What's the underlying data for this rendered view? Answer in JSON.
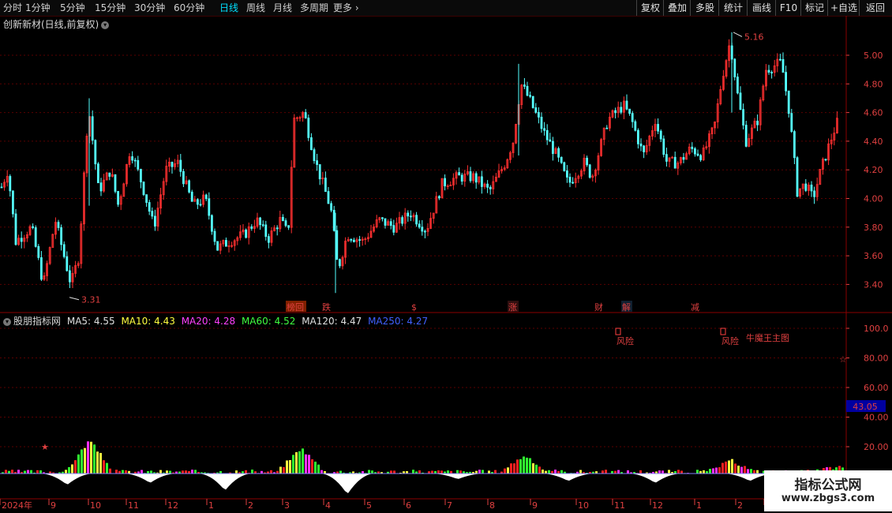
{
  "toolbar": {
    "periods": [
      "分时",
      "1分钟",
      "5分钟",
      "15分钟",
      "30分钟",
      "60分钟",
      "日线",
      "周线",
      "月线",
      "多周期",
      "更多"
    ],
    "active_period": "日线",
    "right_buttons": [
      "复权",
      "叠加",
      "多股",
      "统计",
      "画线",
      "F10",
      "标记",
      "+自选",
      "返回"
    ]
  },
  "main_chart": {
    "title": "创新新材(日线,前复权)",
    "high_label": "5.16",
    "low_label": "3.31",
    "y_ticks": [
      "5.00",
      "4.80",
      "4.60",
      "4.40",
      "4.20",
      "4.00",
      "3.80",
      "3.60",
      "3.40"
    ],
    "event_labels": [
      {
        "text": "榜回",
        "color": "#ffa040",
        "bg": "#802000"
      },
      {
        "text": "跌",
        "color": "#40ff40",
        "bg": ""
      },
      {
        "text": "$",
        "color": "#ff3030",
        "bg": ""
      },
      {
        "text": "涨",
        "color": "#ff4040",
        "bg": "#301010"
      },
      {
        "text": "财",
        "color": "#40c0ff",
        "bg": ""
      },
      {
        "text": "解",
        "color": "#40c0ff",
        "bg": "#102030"
      },
      {
        "text": "减",
        "color": "#40ff40",
        "bg": ""
      }
    ],
    "colors": {
      "up": "#ff3030",
      "down": "#54ffff",
      "grid": "#5a0000"
    }
  },
  "indicator": {
    "name": "股朋指标网",
    "ma_items": [
      {
        "label": "MA5: 4.55",
        "color": "#e0e0e0"
      },
      {
        "label": "MA10: 4.43",
        "color": "#ffff40"
      },
      {
        "label": "MA20: 4.28",
        "color": "#ff40ff"
      },
      {
        "label": "MA60: 4.52",
        "color": "#40ff40"
      },
      {
        "label": "MA120: 4.47",
        "color": "#e0e0e0"
      },
      {
        "label": "MA250: 4.27",
        "color": "#4060ff"
      }
    ],
    "y_ticks": [
      "100.0",
      "80.00",
      "60.00",
      "40.00",
      "20.00"
    ],
    "current_value": "43.05",
    "risk_label_1": "风险",
    "risk_label_2": "风险",
    "brand_label": "牛魔王主图"
  },
  "x_axis": {
    "labels": [
      "2024年",
      "9",
      "10",
      "11",
      "12",
      "1",
      "2",
      "3",
      "4",
      "5",
      "6",
      "7",
      "8",
      "9",
      "10",
      "11",
      "12",
      "1",
      "2",
      "3"
    ]
  },
  "watermark": {
    "line1": "指标公式网",
    "line2": "www.zbgs3.com"
  }
}
